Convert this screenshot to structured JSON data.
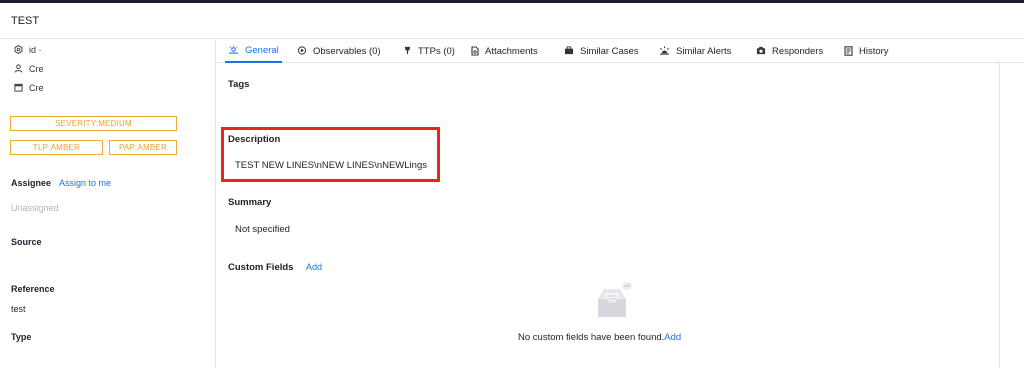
{
  "header": {
    "title": "TEST"
  },
  "sidebar": {
    "meta": [
      {
        "icon": "settings-icon",
        "label": "id ·"
      },
      {
        "icon": "user-icon",
        "label": "Crea"
      },
      {
        "icon": "calendar-icon",
        "label": "Crea"
      }
    ],
    "badges": {
      "severity": "SEVERITY:MEDIUM",
      "tlp": "TLP:AMBER",
      "pap": "PAP:AMBER"
    },
    "assignee": {
      "label": "Assignee",
      "action": "Assign to me",
      "value": "Unassigned"
    },
    "source": {
      "label": "Source",
      "value": ""
    },
    "reference": {
      "label": "Reference",
      "value": "test"
    },
    "type": {
      "label": "Type",
      "value": ""
    }
  },
  "tabs": [
    {
      "label": "General",
      "icon": "general-icon",
      "active": true
    },
    {
      "label": "Observables (0)",
      "icon": "observables-icon",
      "active": false
    },
    {
      "label": "TTPs (0)",
      "icon": "ttps-icon",
      "active": false
    },
    {
      "label": "Attachments",
      "icon": "attachment-icon",
      "active": false
    },
    {
      "label": "Similar Cases",
      "icon": "briefcase-icon",
      "active": false
    },
    {
      "label": "Similar Alerts",
      "icon": "alerts-icon",
      "active": false
    },
    {
      "label": "Responders",
      "icon": "responders-icon",
      "active": false
    },
    {
      "label": "History",
      "icon": "history-icon",
      "active": false
    }
  ],
  "general": {
    "tags_label": "Tags",
    "description_label": "Description",
    "description_text": "TEST NEW LINES\\nNEW LINES\\nNEWLings",
    "summary_label": "Summary",
    "summary_text": "Not specified",
    "custom_fields_label": "Custom Fields",
    "custom_fields_add": "Add",
    "empty_message": "No custom fields have been found.",
    "empty_add": "Add"
  },
  "colors": {
    "accent": "#1a73e8",
    "badge": "#f0a93b",
    "highlight": "#e8271b",
    "topbar": "#1b1a33"
  }
}
